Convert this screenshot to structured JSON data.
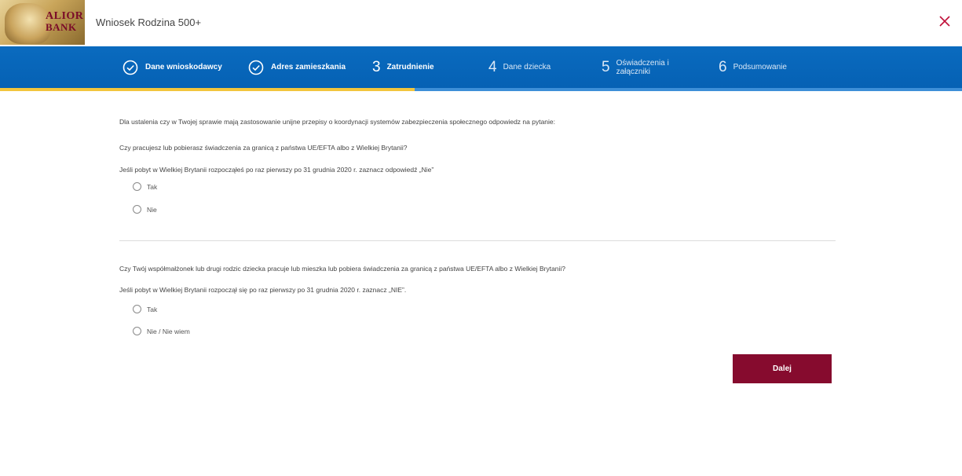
{
  "header": {
    "logo_line1": "ALIOR",
    "logo_line2": "BANK",
    "title": "Wniosek Rodzina 500+",
    "close_icon": "close-icon",
    "accent_color": "#c0113a"
  },
  "stepper": {
    "background": "#0561b3",
    "progress_color": "#f2c53d",
    "steps": [
      {
        "number": "",
        "label": "Dane wnioskodawcy",
        "state": "done",
        "icon": "check-circle-icon"
      },
      {
        "number": "",
        "label": "Adres zamieszkania",
        "state": "done",
        "icon": "check-circle-icon"
      },
      {
        "number": "3",
        "label": "Zatrudnienie",
        "state": "current"
      },
      {
        "number": "4",
        "label": "Dane dziecka",
        "state": "future"
      },
      {
        "number": "5",
        "label": "Oświadczenia i załączniki",
        "state": "future"
      },
      {
        "number": "6",
        "label": "Podsumowanie",
        "state": "future"
      }
    ]
  },
  "form": {
    "intro": "Dla ustalenia czy w Twojej sprawie mają zastosowanie unijne przepisy o koordynacji systemów zabezpieczenia społecznego odpowiedz na pytanie:",
    "q1": {
      "question": "Czy pracujesz lub pobierasz świadczenia za granicą z państwa UE/EFTA albo z Wielkiej Brytanii?",
      "hint": "Jeśli pobyt w Wielkiej Brytanii rozpocząłeś po raz pierwszy po 31 grudnia 2020 r. zaznacz odpowiedź „Nie”",
      "options": [
        "Tak",
        "Nie"
      ]
    },
    "q2": {
      "question": "Czy Twój współmałżonek lub drugi rodzic dziecka pracuje lub mieszka lub pobiera świadczenia za granicą z państwa UE/EFTA albo z Wielkiej Brytanii?",
      "hint": "Jeśli pobyt w Wielkiej Brytanii rozpoczął się po raz pierwszy po 31 grudnia 2020 r. zaznacz „NIE”.",
      "options": [
        "Tak",
        "Nie / Nie wiem"
      ]
    },
    "next_label": "Dalej",
    "next_color": "#860b2e"
  }
}
